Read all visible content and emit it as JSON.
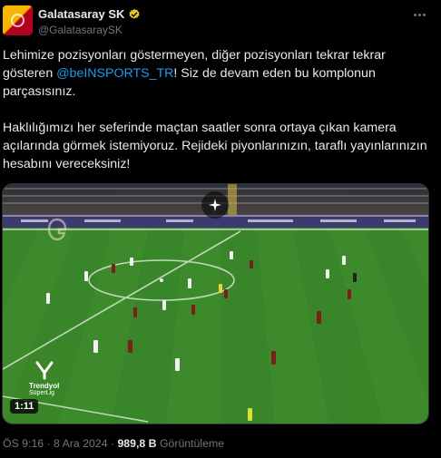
{
  "tweet": {
    "display_name": "Galatasaray SK",
    "handle": "@GalatasaraySK",
    "text_line1_a": "Lehimize pozisyonları göstermeyen, diğer pozisyonları tekrar tekrar gösteren ",
    "mention": "@beINSPORTS_TR",
    "text_line1_b": "! Siz de devam eden bu komplonun parçasısınız.",
    "text_paragraph2": "Haklılığımızı her seferinde maçtan saatler sonra ortaya çıkan kamera açılarında görmek istemiyoruz. Rejideki piyonlarınızın, taraflı yayınlarınızın hesabını vereceksiniz!",
    "timestamp": "ÖS 9:16 · 8 Ara 2024 · ",
    "views": "989,8 B",
    "views_label": " Görüntüleme"
  },
  "media": {
    "duration": "1:11",
    "watermark_line1": "Trendyol",
    "watermark_line2": "SüperLig"
  },
  "colors": {
    "accent": "#1d9bf0",
    "verified": "#e8c51f",
    "pitch": "#3d8a2c"
  },
  "icons": {
    "verified": "verified-badge-icon",
    "more": "more-options-icon",
    "gif": "sparkle-icon"
  }
}
